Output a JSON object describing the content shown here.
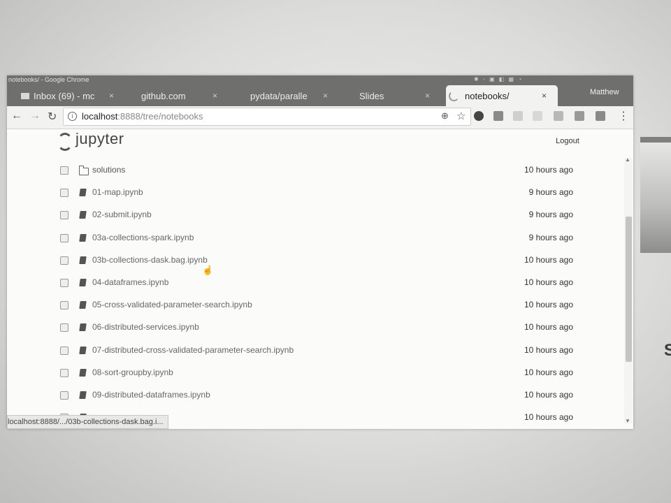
{
  "window": {
    "title": "notebooks/ - Google Chrome",
    "user": "Matthew"
  },
  "tabs": [
    {
      "label": "Inbox (69) - mc",
      "icon": "mail-icon",
      "active": false
    },
    {
      "label": "github.com",
      "active": false
    },
    {
      "label": "pydata/paralle",
      "active": false
    },
    {
      "label": "Slides",
      "active": false
    },
    {
      "label": "notebooks/",
      "icon": "jupyter-spinner-icon",
      "active": true
    }
  ],
  "tab_close": "×",
  "address": {
    "host": "localhost",
    "rest": ":8888/tree/notebooks"
  },
  "jupyter": {
    "logo_text": "jupyter",
    "logout_label": "Logout"
  },
  "files": [
    {
      "name": "solutions",
      "type": "folder",
      "modified": "10 hours ago"
    },
    {
      "name": "01-map.ipynb",
      "type": "notebook",
      "modified": "9 hours ago"
    },
    {
      "name": "02-submit.ipynb",
      "type": "notebook",
      "modified": "9 hours ago"
    },
    {
      "name": "03a-collections-spark.ipynb",
      "type": "notebook",
      "modified": "9 hours ago"
    },
    {
      "name": "03b-collections-dask.bag.ipynb",
      "type": "notebook",
      "modified": "10 hours ago"
    },
    {
      "name": "04-dataframes.ipynb",
      "type": "notebook",
      "modified": "10 hours ago"
    },
    {
      "name": "05-cross-validated-parameter-search.ipynb",
      "type": "notebook",
      "modified": "10 hours ago"
    },
    {
      "name": "06-distributed-services.ipynb",
      "type": "notebook",
      "modified": "10 hours ago"
    },
    {
      "name": "07-distributed-cross-validated-parameter-search.ipynb",
      "type": "notebook",
      "modified": "10 hours ago"
    },
    {
      "name": "08-sort-groupby.ipynb",
      "type": "notebook",
      "modified": "10 hours ago"
    },
    {
      "name": "09-distributed-dataframes.ipynb",
      "type": "notebook",
      "modified": "10 hours ago"
    },
    {
      "name": "",
      "type": "notebook",
      "modified": "10 hours ago"
    }
  ],
  "status_bar": "localhost:8888/.../03b-collections-dask.bag.i...",
  "colors": {
    "titlebar": "#6f6f6d",
    "page": "#fbfbf9"
  }
}
